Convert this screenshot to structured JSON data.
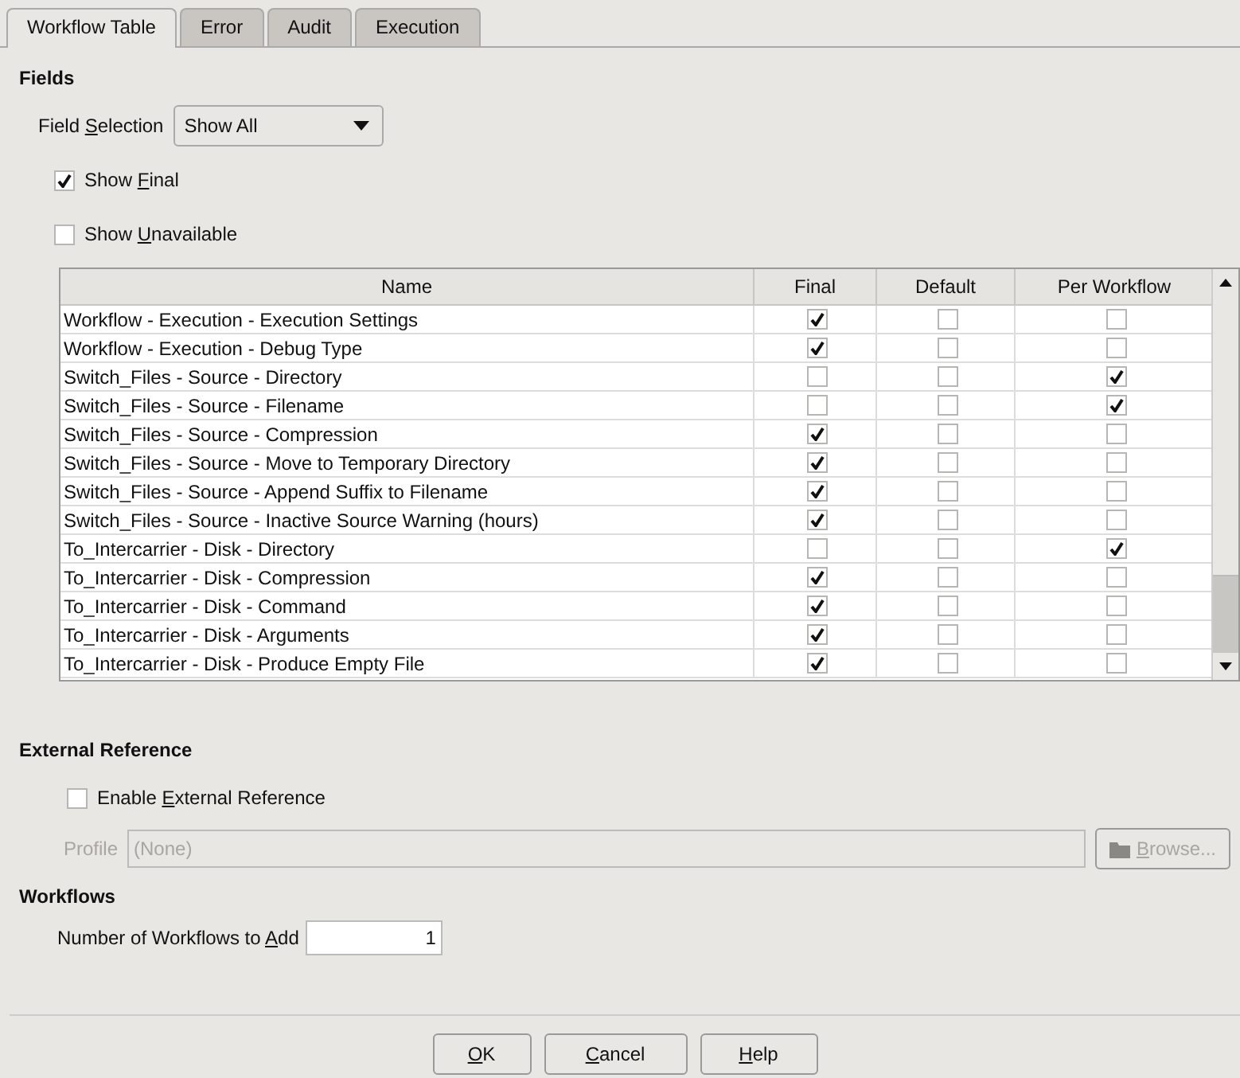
{
  "tabs": [
    {
      "label": "Workflow Table",
      "selected": true
    },
    {
      "label": "Error",
      "selected": false
    },
    {
      "label": "Audit",
      "selected": false
    },
    {
      "label": "Execution",
      "selected": false
    }
  ],
  "fields": {
    "heading": "Fields",
    "field_selection": {
      "label": {
        "before": "Field ",
        "key": "S",
        "after": "election"
      },
      "value": "Show All"
    },
    "options": [
      {
        "label": {
          "before": "Show ",
          "key": "F",
          "after": "inal"
        },
        "checked": true
      },
      {
        "label": {
          "before": "Show ",
          "key": "U",
          "after": "navailable"
        },
        "checked": false
      }
    ]
  },
  "table": {
    "columns": [
      "Name",
      "Final",
      "Default",
      "Per Workflow"
    ],
    "rows": [
      {
        "name": "Workflow - Execution - Execution Settings",
        "final": true,
        "default": false,
        "per_workflow": false
      },
      {
        "name": "Workflow - Execution - Debug Type",
        "final": true,
        "default": false,
        "per_workflow": false
      },
      {
        "name": "Switch_Files - Source - Directory",
        "final": false,
        "default": false,
        "per_workflow": true
      },
      {
        "name": "Switch_Files - Source - Filename",
        "final": false,
        "default": false,
        "per_workflow": true
      },
      {
        "name": "Switch_Files - Source - Compression",
        "final": true,
        "default": false,
        "per_workflow": false
      },
      {
        "name": "Switch_Files - Source - Move to Temporary Directory",
        "final": true,
        "default": false,
        "per_workflow": false
      },
      {
        "name": "Switch_Files - Source - Append Suffix to Filename",
        "final": true,
        "default": false,
        "per_workflow": false
      },
      {
        "name": "Switch_Files - Source - Inactive Source Warning (hours)",
        "final": true,
        "default": false,
        "per_workflow": false
      },
      {
        "name": "To_Intercarrier - Disk - Directory",
        "final": false,
        "default": false,
        "per_workflow": true
      },
      {
        "name": "To_Intercarrier - Disk - Compression",
        "final": true,
        "default": false,
        "per_workflow": false
      },
      {
        "name": "To_Intercarrier - Disk - Command",
        "final": true,
        "default": false,
        "per_workflow": false
      },
      {
        "name": "To_Intercarrier - Disk - Arguments",
        "final": true,
        "default": false,
        "per_workflow": false
      },
      {
        "name": "To_Intercarrier - Disk - Produce Empty File",
        "final": true,
        "default": false,
        "per_workflow": false
      }
    ]
  },
  "external_reference": {
    "heading": "External Reference",
    "enable": {
      "label": {
        "before": "Enable ",
        "key": "E",
        "after": "xternal Reference"
      },
      "checked": false
    },
    "profile": {
      "label": "Profile",
      "placeholder": "(None)",
      "disabled": true
    },
    "browse": {
      "label": {
        "key": "B",
        "after": "rowse..."
      },
      "disabled": true
    }
  },
  "workflows": {
    "heading": "Workflows",
    "count": {
      "label": {
        "before": "Number of Workflows to ",
        "key": "A",
        "after": "dd"
      },
      "value": "1"
    }
  },
  "buttons": [
    {
      "label": {
        "key": "O",
        "after": "K"
      }
    },
    {
      "label": {
        "key": "C",
        "after": "ancel"
      }
    },
    {
      "label": {
        "key": "H",
        "after": "elp"
      }
    }
  ]
}
